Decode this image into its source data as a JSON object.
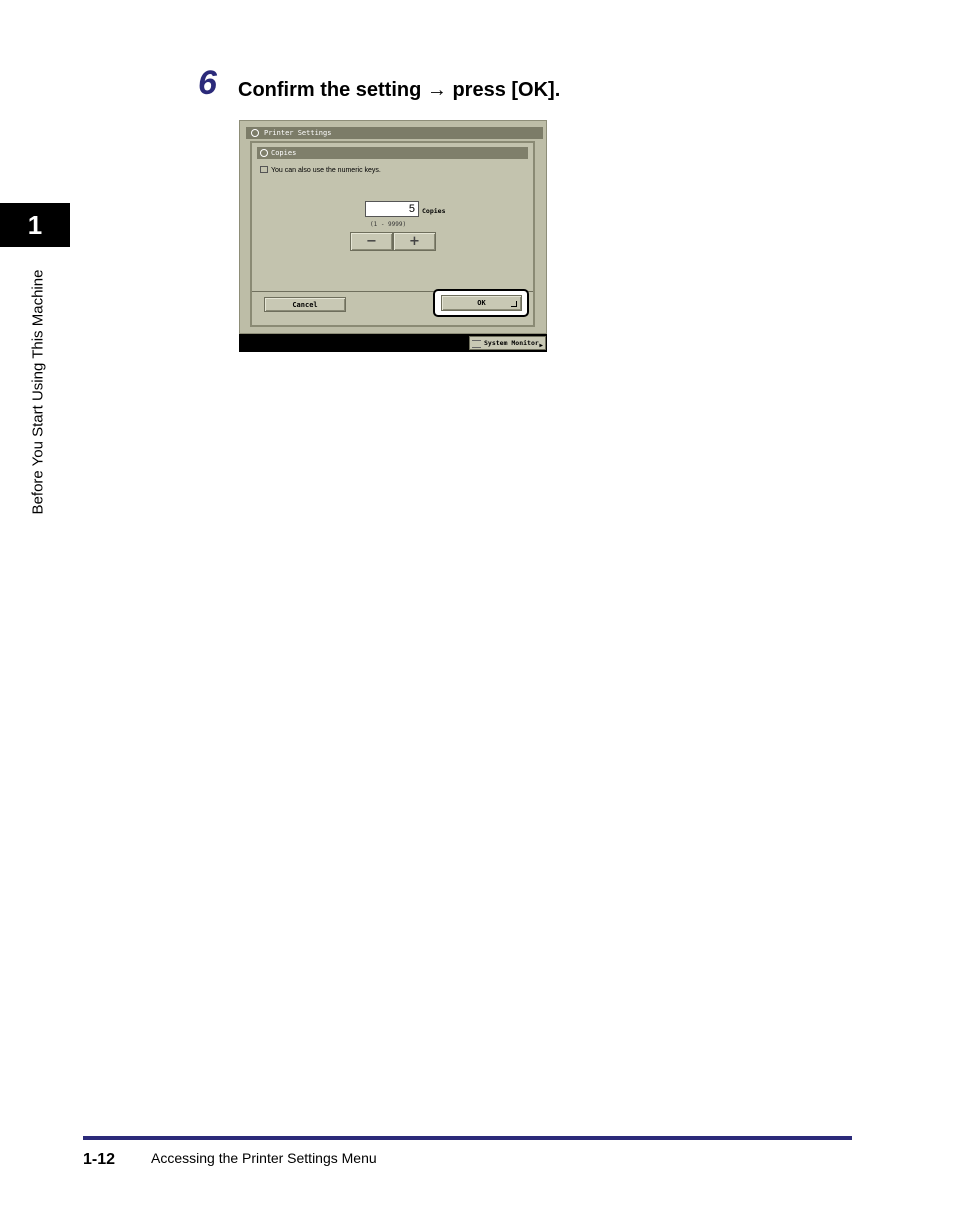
{
  "step": {
    "number": "6",
    "instruction": "Confirm the setting → press [OK]."
  },
  "chapter": {
    "number": "1",
    "side_title": "Before You Start Using This Machine"
  },
  "screen": {
    "title": "Printer Settings",
    "subtitle": "Copies",
    "hint": "You can also use the numeric keys.",
    "copies_value": "5",
    "copies_unit": "Copies",
    "range": "(1 - 9999)",
    "minus_label": "−",
    "plus_label": "+",
    "cancel_label": "Cancel",
    "ok_label": "OK",
    "system_monitor_label": "System Monitor",
    "icons": {
      "title": "printer-icon",
      "subtitle": "copies-icon",
      "hint": "keypad-icon",
      "system_monitor": "list-icon",
      "system_monitor_arrow": "triangle-right-icon"
    },
    "colors": {
      "panel": "#bdbda7",
      "title_bar": "#7c7c68",
      "status_bar": "#000000"
    }
  },
  "footer": {
    "page_number": "1-12",
    "section_title": "Accessing the Printer Settings Menu",
    "rule_color": "#2b2a7a"
  }
}
